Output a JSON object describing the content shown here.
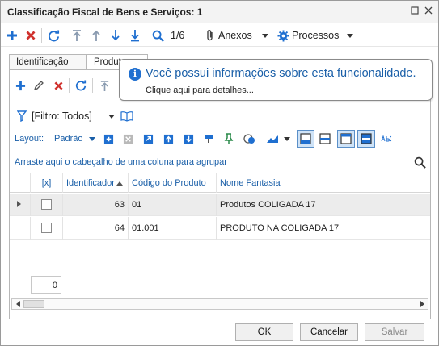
{
  "window": {
    "title": "Classificação Fiscal de Bens e Serviços: 1"
  },
  "toolbar": {
    "record_position": "1/6",
    "attachments_label": "Anexos",
    "processes_label": "Processos"
  },
  "tabs": [
    {
      "label": "Identificação"
    },
    {
      "label": "Produtos"
    }
  ],
  "tooltip": {
    "title": "Você possui informações sobre esta funcionalidade.",
    "subtitle": "Clique aqui para detalhes..."
  },
  "filter": {
    "label": "[Filtro: Todos]"
  },
  "layout": {
    "label": "Layout:",
    "value": "Padrão"
  },
  "group_hint": "Arraste aqui o cabeçalho de uma coluna para agrupar",
  "grid": {
    "columns": [
      "[x]",
      "Identificador",
      "Código do Produto",
      "Nome Fantasia"
    ],
    "rows": [
      {
        "id": "63",
        "code": "01",
        "name": "Produtos COLIGADA 17",
        "checked": false
      },
      {
        "id": "64",
        "code": "01.001",
        "name": "PRODUTO NA COLIGADA 17",
        "checked": false
      }
    ],
    "footer_count": "0"
  },
  "buttons": {
    "ok": "OK",
    "cancel": "Cancelar",
    "save": "Salvar"
  },
  "colors": {
    "accent_blue": "#1a5fa8",
    "add_blue": "#1f6fd0",
    "delete_red": "#d0312d"
  },
  "icons": [
    "add-icon",
    "delete-icon",
    "refresh-icon",
    "first-record-icon",
    "previous-record-icon",
    "next-record-icon",
    "last-record-icon",
    "search-icon",
    "paperclip-icon",
    "gear-icon",
    "edit-icon",
    "filter-icon",
    "book-icon",
    "info-icon"
  ]
}
